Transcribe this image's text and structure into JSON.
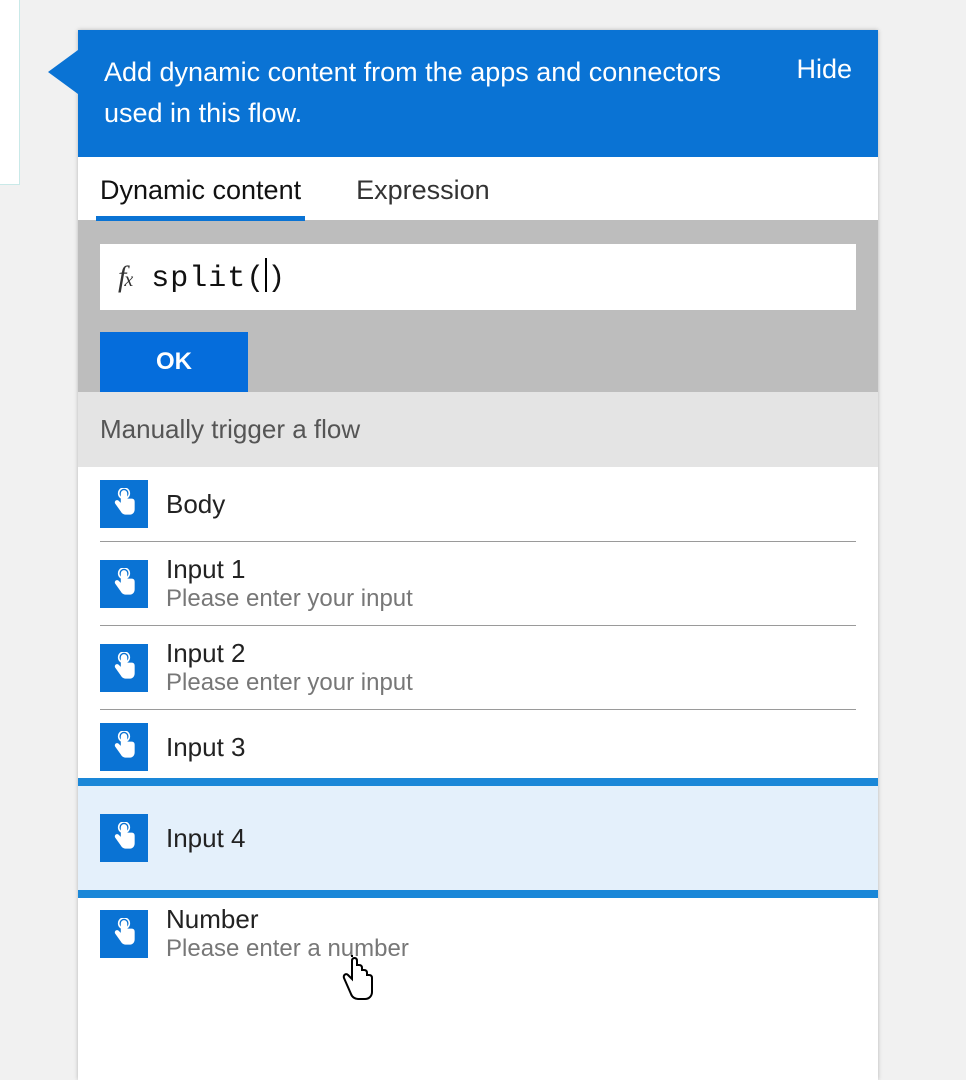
{
  "header": {
    "description": "Add dynamic content from the apps and connectors used in this flow.",
    "hide_label": "Hide"
  },
  "tabs": {
    "dynamic_content": "Dynamic content",
    "expression": "Expression",
    "active": "dynamic_content"
  },
  "formula": {
    "fx_label": "fx",
    "value": "split()",
    "ok_label": "OK"
  },
  "section": {
    "title": "Manually trigger a flow"
  },
  "items": [
    {
      "label": "Body",
      "desc": ""
    },
    {
      "label": "Input 1",
      "desc": "Please enter your input"
    },
    {
      "label": "Input 2",
      "desc": "Please enter your input"
    },
    {
      "label": "Input 3",
      "desc": ""
    },
    {
      "label": "Input 4",
      "desc": "",
      "highlight": true
    },
    {
      "label": "Number",
      "desc": "Please enter a number"
    }
  ]
}
